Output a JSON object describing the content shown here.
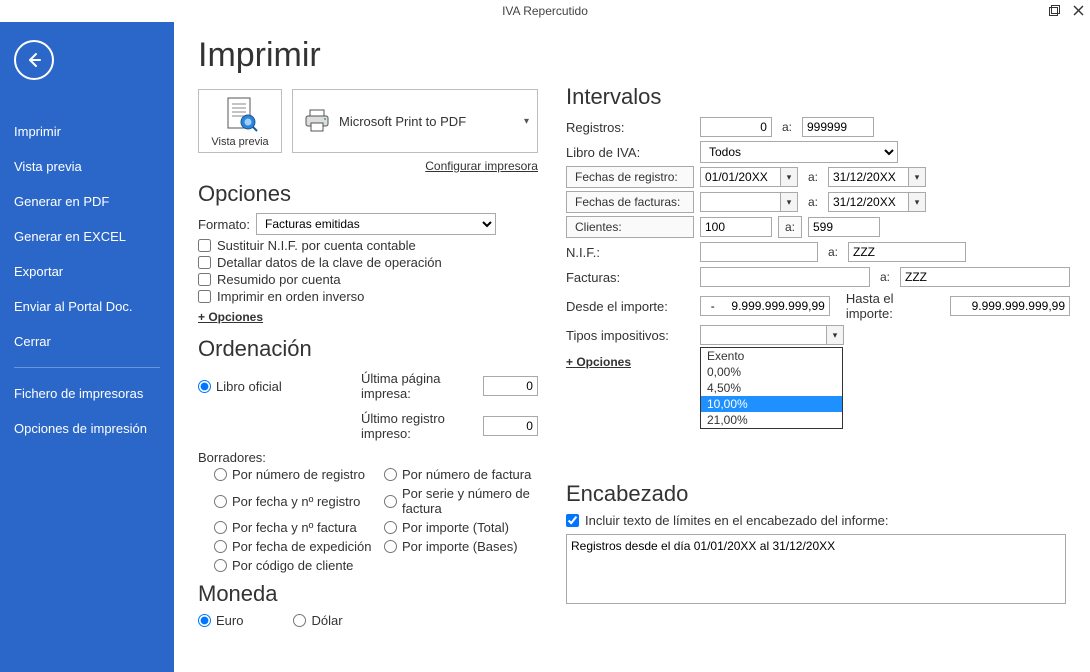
{
  "window": {
    "title": "IVA Repercutido"
  },
  "sidebar": {
    "items": [
      {
        "label": "Imprimir"
      },
      {
        "label": "Vista previa"
      },
      {
        "label": "Generar en PDF"
      },
      {
        "label": "Generar en EXCEL"
      },
      {
        "label": "Exportar"
      },
      {
        "label": "Enviar al Portal Doc."
      },
      {
        "label": "Cerrar"
      }
    ],
    "secondary": [
      {
        "label": "Fichero de impresoras"
      },
      {
        "label": "Opciones de impresión"
      }
    ]
  },
  "page": {
    "title": "Imprimir",
    "preview_label": "Vista previa",
    "printer_name": "Microsoft Print to PDF",
    "configure_printer": "Configurar impresora"
  },
  "opciones": {
    "heading": "Opciones",
    "formato_label": "Formato:",
    "formato_value": "Facturas emitidas",
    "chk1": "Sustituir N.I.F. por cuenta contable",
    "chk2": "Detallar datos de la clave de operación",
    "chk3": "Resumido por cuenta",
    "chk4": "Imprimir en orden inverso",
    "more": "+ Opciones"
  },
  "ordenacion": {
    "heading": "Ordenación",
    "libro_oficial": "Libro oficial",
    "ultima_pagina": "Última página impresa:",
    "ultima_pagina_val": "0",
    "ultimo_registro": "Último registro impreso:",
    "ultimo_registro_val": "0",
    "borradores": "Borradores:",
    "r1": "Por número de registro",
    "r2": "Por número de factura",
    "r3": "Por fecha y nº registro",
    "r4": "Por serie y número de factura",
    "r5": "Por fecha y nº factura",
    "r6": "Por importe (Total)",
    "r7": "Por fecha de expedición",
    "r8": "Por importe (Bases)",
    "r9": "Por código de cliente"
  },
  "moneda": {
    "heading": "Moneda",
    "euro": "Euro",
    "dolar": "Dólar"
  },
  "intervalos": {
    "heading": "Intervalos",
    "registros": "Registros:",
    "registros_from": "0",
    "registros_to": "999999",
    "libro_iva": "Libro de IVA:",
    "libro_iva_val": "Todos",
    "fechas_registro": "Fechas de registro:",
    "fr_from": "01/01/20XX",
    "fr_to": "31/12/20XX",
    "fechas_facturas": "Fechas de facturas:",
    "ff_from": "",
    "ff_to": "31/12/20XX",
    "clientes": "Clientes:",
    "cli_from": "100",
    "cli_to": "599",
    "nif": "N.I.F.:",
    "nif_from": "",
    "nif_to": "ZZZ",
    "facturas": "Facturas:",
    "fac_from": "",
    "fac_to": "ZZZ",
    "desde_importe": "Desde el importe:",
    "desde_importe_val": "-     9.999.999.999,99",
    "hasta_importe": "Hasta el importe:",
    "hasta_importe_val": "9.999.999.999,99",
    "tipos_impositivos": "Tipos impositivos:",
    "tipos_options": [
      "Exento",
      "0,00%",
      "4,50%",
      "10,00%",
      "21,00%"
    ],
    "tipos_selected_index": 3,
    "more": "+ Opciones",
    "a": "a:"
  },
  "encabezado": {
    "heading": "Encabezado",
    "chk": "Incluir texto de límites en el encabezado del informe:",
    "text": "Registros desde el día 01/01/20XX al 31/12/20XX"
  }
}
